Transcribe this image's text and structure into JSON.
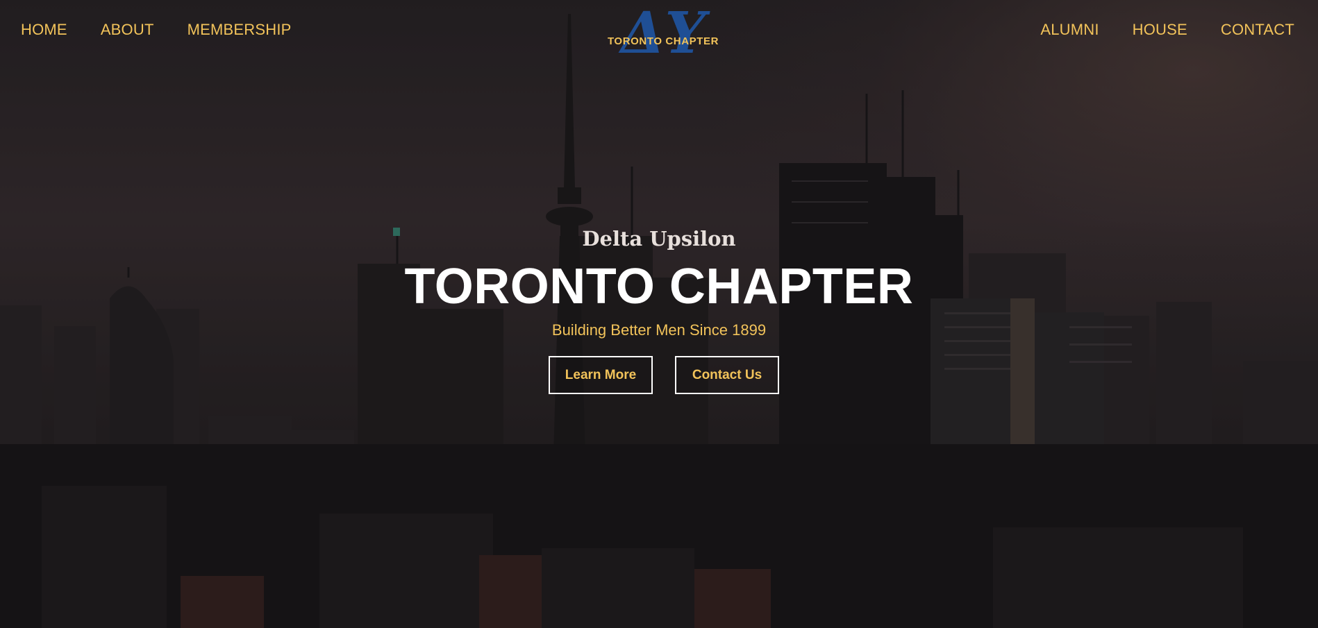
{
  "nav": {
    "left": [
      {
        "label": "HOME",
        "name": "nav-home"
      },
      {
        "label": "ABOUT",
        "name": "nav-about"
      },
      {
        "label": "MEMBERSHIP",
        "name": "nav-membership"
      }
    ],
    "right": [
      {
        "label": "ALUMNI",
        "name": "nav-alumni"
      },
      {
        "label": "HOUSE",
        "name": "nav-house"
      },
      {
        "label": "CONTACT",
        "name": "nav-contact"
      }
    ],
    "logo": {
      "glyph": "ΔΥ",
      "text": "TORONTO CHAPTER"
    }
  },
  "hero": {
    "pre_title": "Delta Upsilon",
    "title": "TORONTO CHAPTER",
    "tagline": "Building Better Men Since 1899",
    "buttons": {
      "learn_more": "Learn More",
      "contact_us": "Contact Us"
    }
  },
  "colors": {
    "accent_gold": "#f2c35a",
    "logo_blue": "#1f4f95",
    "title_white": "#ffffff"
  }
}
